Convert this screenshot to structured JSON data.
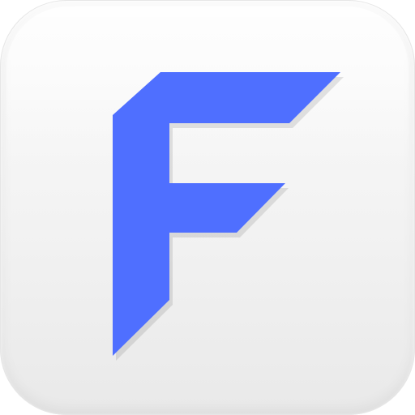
{
  "icon": {
    "name": "F-app-icon",
    "symbol": "F",
    "colors": {
      "primary_blue": "#4F6FFF",
      "shadow_blue": "#3C5CF0",
      "tile_top": "#FBFBFB",
      "tile_bottom": "#E9E9E9"
    }
  }
}
